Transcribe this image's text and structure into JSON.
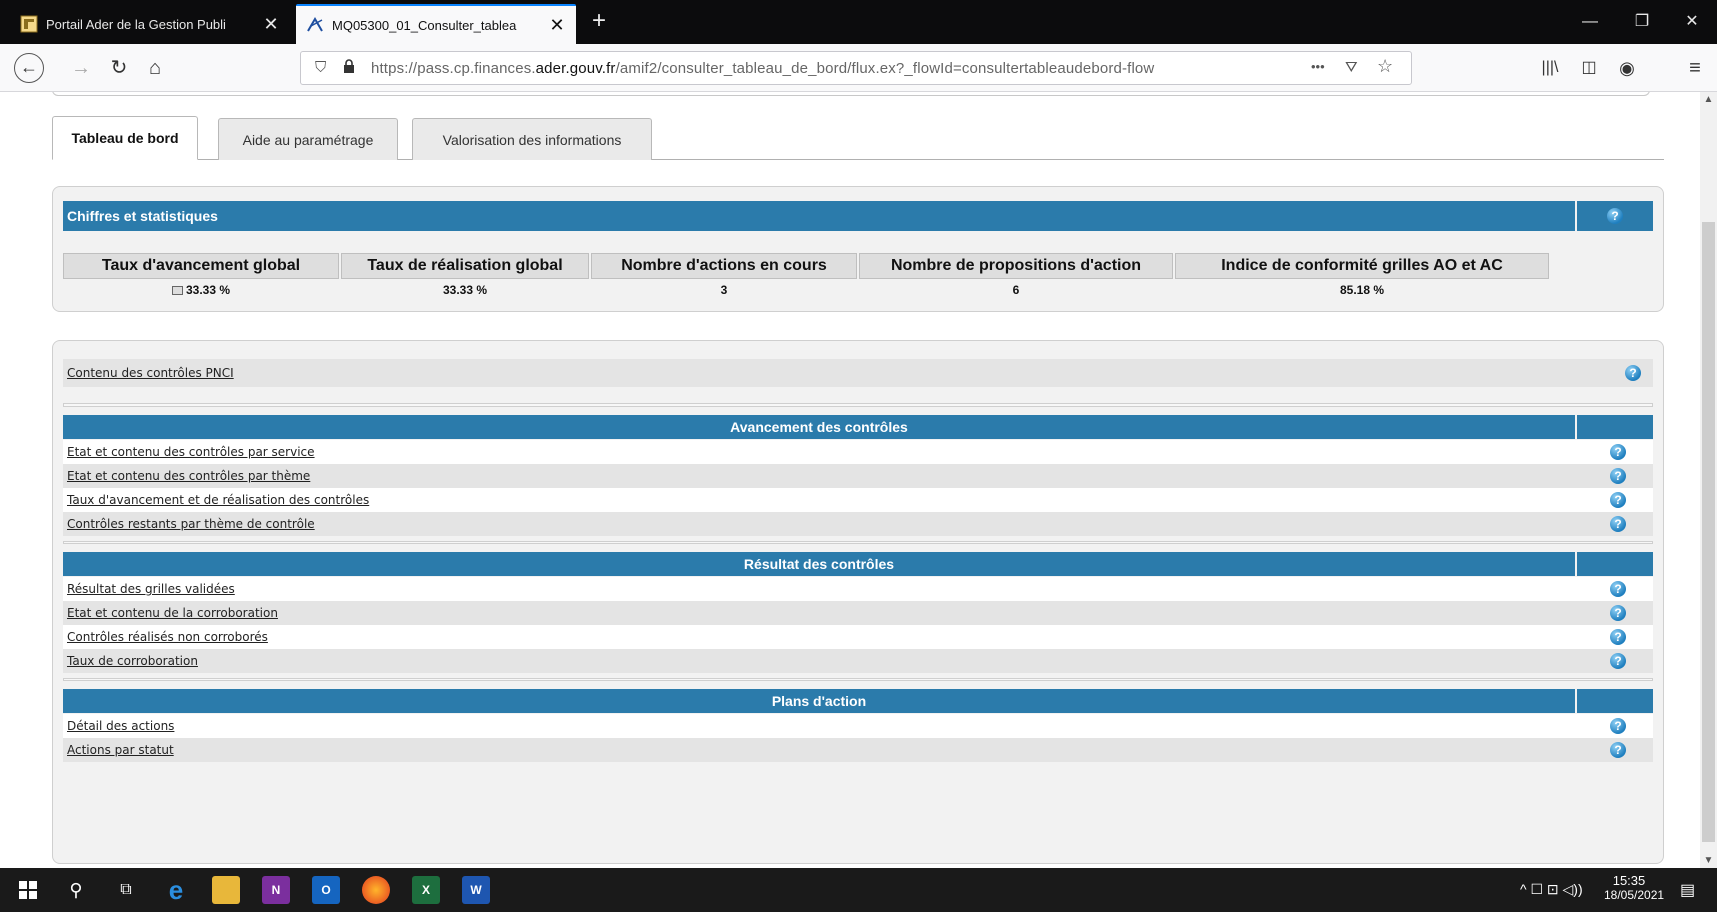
{
  "browser": {
    "tabs": [
      {
        "title": "Portail Ader de la Gestion Publi",
        "close": "✕"
      },
      {
        "title": "MQ05300_01_Consulter_tablea",
        "close": "✕"
      }
    ],
    "new_tab": "+",
    "url_prefix": "https://pass.cp.finances.",
    "url_domain": "ader.gouv.fr",
    "url_suffix": "/amif2/consulter_tableau_de_bord/flux.ex?_flowId=consultertableaudebord-flow",
    "url_more": "•••"
  },
  "page_tabs": [
    "Tableau de bord",
    "Aide au paramétrage",
    "Valorisation des informations"
  ],
  "stats": {
    "title": "Chiffres et statistiques",
    "help": "?",
    "columns": [
      {
        "header": "Taux d'avancement global",
        "value": "33.33 %"
      },
      {
        "header": "Taux de réalisation global",
        "value": "33.33 %"
      },
      {
        "header": "Nombre d'actions en cours",
        "value": "3"
      },
      {
        "header": "Nombre de propositions d'action",
        "value": "6"
      },
      {
        "header": "Indice de conformité grilles AO et AC",
        "value": "85.18 %"
      }
    ]
  },
  "pnci": {
    "label": "Contenu des contrôles PNCI",
    "help": "?"
  },
  "sections": [
    {
      "title": "Avancement des contrôles",
      "links": [
        "Etat et contenu des contrôles par service",
        "Etat et contenu des contrôles par thème",
        "Taux d'avancement et de réalisation des contrôles",
        "Contrôles restants par thème de contrôle"
      ]
    },
    {
      "title": "Résultat des contrôles",
      "links": [
        "Résultat des grilles validées",
        "Etat et contenu de la corroboration",
        "Contrôles réalisés non corroborés",
        "Taux de corroboration"
      ]
    },
    {
      "title": "Plans d'action",
      "links": [
        "Détail des actions",
        "Actions par statut"
      ]
    }
  ],
  "taskbar": {
    "time": "15:35",
    "date": "18/05/2021"
  },
  "colors": {
    "header_blue": "#2b7bab",
    "row_alt": "#e4e4e4"
  }
}
